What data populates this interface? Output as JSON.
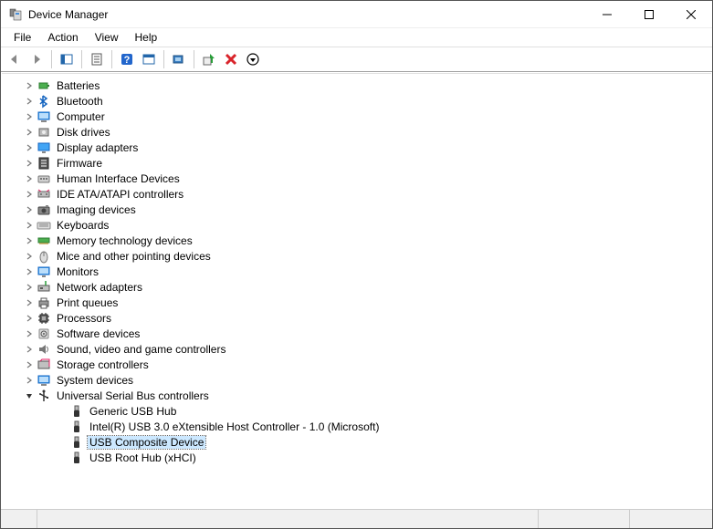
{
  "window": {
    "title": "Device Manager"
  },
  "menu": {
    "file": "File",
    "action": "Action",
    "view": "View",
    "help": "Help"
  },
  "toolbar": {
    "back": "back",
    "forward": "forward",
    "show_hide": "show-hide-console-tree",
    "properties": "properties",
    "help": "help",
    "update": "update-driver",
    "scan": "scan-hardware-changes",
    "enable": "enable-device",
    "uninstall": "uninstall-device",
    "arrow_down": "dropdown"
  },
  "tree": {
    "categories": [
      {
        "icon": "battery",
        "label": "Batteries"
      },
      {
        "icon": "bluetooth",
        "label": "Bluetooth"
      },
      {
        "icon": "computer",
        "label": "Computer"
      },
      {
        "icon": "disk",
        "label": "Disk drives"
      },
      {
        "icon": "display",
        "label": "Display adapters"
      },
      {
        "icon": "firmware",
        "label": "Firmware"
      },
      {
        "icon": "hid",
        "label": "Human Interface Devices"
      },
      {
        "icon": "ide",
        "label": "IDE ATA/ATAPI controllers"
      },
      {
        "icon": "imaging",
        "label": "Imaging devices"
      },
      {
        "icon": "keyboard",
        "label": "Keyboards"
      },
      {
        "icon": "memory",
        "label": "Memory technology devices"
      },
      {
        "icon": "mouse",
        "label": "Mice and other pointing devices"
      },
      {
        "icon": "monitor",
        "label": "Monitors"
      },
      {
        "icon": "network",
        "label": "Network adapters"
      },
      {
        "icon": "printer",
        "label": "Print queues"
      },
      {
        "icon": "processor",
        "label": "Processors"
      },
      {
        "icon": "software",
        "label": "Software devices"
      },
      {
        "icon": "sound",
        "label": "Sound, video and game controllers"
      },
      {
        "icon": "storage",
        "label": "Storage controllers"
      },
      {
        "icon": "system",
        "label": "System devices"
      }
    ],
    "usb": {
      "label": "Universal Serial Bus controllers",
      "children": [
        {
          "label": "Generic USB Hub"
        },
        {
          "label": "Intel(R) USB 3.0 eXtensible Host Controller - 1.0 (Microsoft)"
        },
        {
          "label": "USB Composite Device",
          "selected": true
        },
        {
          "label": "USB Root Hub (xHCI)"
        }
      ]
    }
  }
}
